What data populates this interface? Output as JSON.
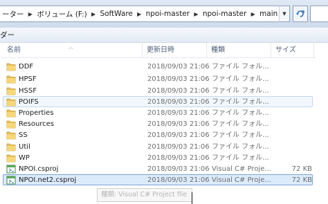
{
  "address": {
    "crumbs": [
      "ーター",
      "ボリューム (F:)",
      "SoftWare",
      "npoi-master",
      "npoi-master",
      "main"
    ]
  },
  "toolbar": {
    "label": "ダー"
  },
  "columns": {
    "name": "名前",
    "date": "更新日時",
    "type": "種類",
    "size": "サイズ"
  },
  "rows": [
    {
      "name": "DDF",
      "date": "2018/09/03 21:06",
      "type": "ファイル フォル...",
      "size": "",
      "icon": "folder-icon"
    },
    {
      "name": "HPSF",
      "date": "2018/09/03 21:06",
      "type": "ファイル フォル...",
      "size": "",
      "icon": "folder-icon"
    },
    {
      "name": "HSSF",
      "date": "2018/09/03 21:06",
      "type": "ファイル フォル...",
      "size": "",
      "icon": "folder-icon"
    },
    {
      "name": "POIFS",
      "date": "2018/09/03 21:06",
      "type": "ファイル フォル...",
      "size": "",
      "icon": "folder-icon"
    },
    {
      "name": "Properties",
      "date": "2018/09/03 21:06",
      "type": "ファイル フォル...",
      "size": "",
      "icon": "folder-icon"
    },
    {
      "name": "Resources",
      "date": "2018/09/03 21:06",
      "type": "ファイル フォル...",
      "size": "",
      "icon": "folder-icon"
    },
    {
      "name": "SS",
      "date": "2018/09/03 21:06",
      "type": "ファイル フォル...",
      "size": "",
      "icon": "folder-icon"
    },
    {
      "name": "Util",
      "date": "2018/09/03 21:06",
      "type": "ファイル フォル...",
      "size": "",
      "icon": "folder-icon"
    },
    {
      "name": "WP",
      "date": "2018/09/03 21:06",
      "type": "ファイル フォル...",
      "size": "",
      "icon": "folder-icon"
    },
    {
      "name": "NPOI.csproj",
      "date": "2018/09/03 21:06",
      "type": "Visual C# Proje...",
      "size": "72 KB",
      "icon": "csproj-icon"
    },
    {
      "name": "NPOI.net2.csproj",
      "date": "2018/09/03 21:06",
      "type": "Visual C# Proje...",
      "size": "72 KB",
      "icon": "csproj-icon"
    }
  ],
  "tooltip": {
    "text": "種類: Visual C# Project file"
  },
  "colors": {
    "selection": "#dcebfc",
    "selection_border": "#7da2ce",
    "folder": "#e8c15a",
    "header_text": "#4c607a"
  }
}
